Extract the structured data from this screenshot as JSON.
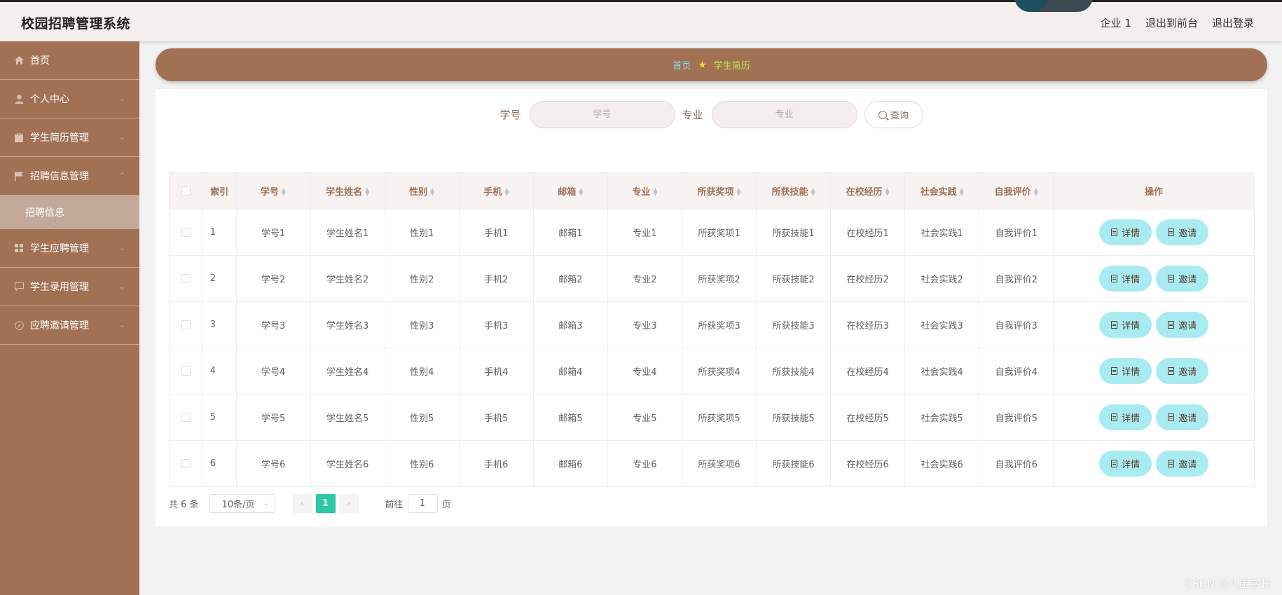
{
  "header": {
    "title": "校园招聘管理系统",
    "links": [
      "企业 1",
      "退出到前台",
      "退出登录"
    ]
  },
  "sidebar": {
    "items": [
      {
        "label": "首页",
        "icon": "home-icon",
        "has_arrow": false
      },
      {
        "label": "个人中心",
        "icon": "user-icon",
        "has_arrow": true
      },
      {
        "label": "学生简历管理",
        "icon": "clipboard-icon",
        "has_arrow": true
      },
      {
        "label": "招聘信息管理",
        "icon": "flag-icon",
        "has_arrow": true,
        "expanded": true
      }
    ],
    "subitem": {
      "label": "招聘信息"
    },
    "items_after": [
      {
        "label": "学生应聘管理",
        "icon": "grid-icon",
        "has_arrow": true
      },
      {
        "label": "学生录用管理",
        "icon": "chat-icon",
        "has_arrow": true
      },
      {
        "label": "应聘邀请管理",
        "icon": "compass-icon",
        "has_arrow": true
      }
    ]
  },
  "breadcrumb": {
    "home": "首页",
    "current": "学生简历"
  },
  "search": {
    "field1_label": "学号",
    "field1_placeholder": "学号",
    "field2_label": "专业",
    "field2_placeholder": "专业",
    "button_label": "查询"
  },
  "table": {
    "columns": [
      "索引",
      "学号",
      "学生姓名",
      "性别",
      "手机",
      "邮箱",
      "专业",
      "所获奖项",
      "所获技能",
      "在校经历",
      "社会实践",
      "自我评价",
      "操作"
    ],
    "rows": [
      [
        "1",
        "学号1",
        "学生姓名1",
        "性别1",
        "手机1",
        "邮箱1",
        "专业1",
        "所获奖项1",
        "所获技能1",
        "在校经历1",
        "社会实践1",
        "自我评价1"
      ],
      [
        "2",
        "学号2",
        "学生姓名2",
        "性别2",
        "手机2",
        "邮箱2",
        "专业2",
        "所获奖项2",
        "所获技能2",
        "在校经历2",
        "社会实践2",
        "自我评价2"
      ],
      [
        "3",
        "学号3",
        "学生姓名3",
        "性别3",
        "手机3",
        "邮箱3",
        "专业3",
        "所获奖项3",
        "所获技能3",
        "在校经历3",
        "社会实践3",
        "自我评价3"
      ],
      [
        "4",
        "学号4",
        "学生姓名4",
        "性别4",
        "手机4",
        "邮箱4",
        "专业4",
        "所获奖项4",
        "所获技能4",
        "在校经历4",
        "社会实践4",
        "自我评价4"
      ],
      [
        "5",
        "学号5",
        "学生姓名5",
        "性别5",
        "手机5",
        "邮箱5",
        "专业5",
        "所获奖项5",
        "所获技能5",
        "在校经历5",
        "社会实践5",
        "自我评价5"
      ],
      [
        "6",
        "学号6",
        "学生姓名6",
        "性别6",
        "手机6",
        "邮箱6",
        "专业6",
        "所获奖项6",
        "所获技能6",
        "在校经历6",
        "社会实践6",
        "自我评价6"
      ]
    ],
    "actions": [
      "详情",
      "邀请"
    ]
  },
  "pagination": {
    "total": "共 6 条",
    "page_size": "10条/页",
    "current_page": "1",
    "goto_prefix": "前往",
    "goto_value": "1",
    "goto_suffix": "页"
  },
  "watermark": "CSDN @八宝学长",
  "colors": {
    "sidebar": "#a27154",
    "accent_button": "#a8ecf2",
    "page_active": "#2fc8a5",
    "breadcrumb_home": "#7fe0f0",
    "breadcrumb_current": "#b7e94b"
  }
}
